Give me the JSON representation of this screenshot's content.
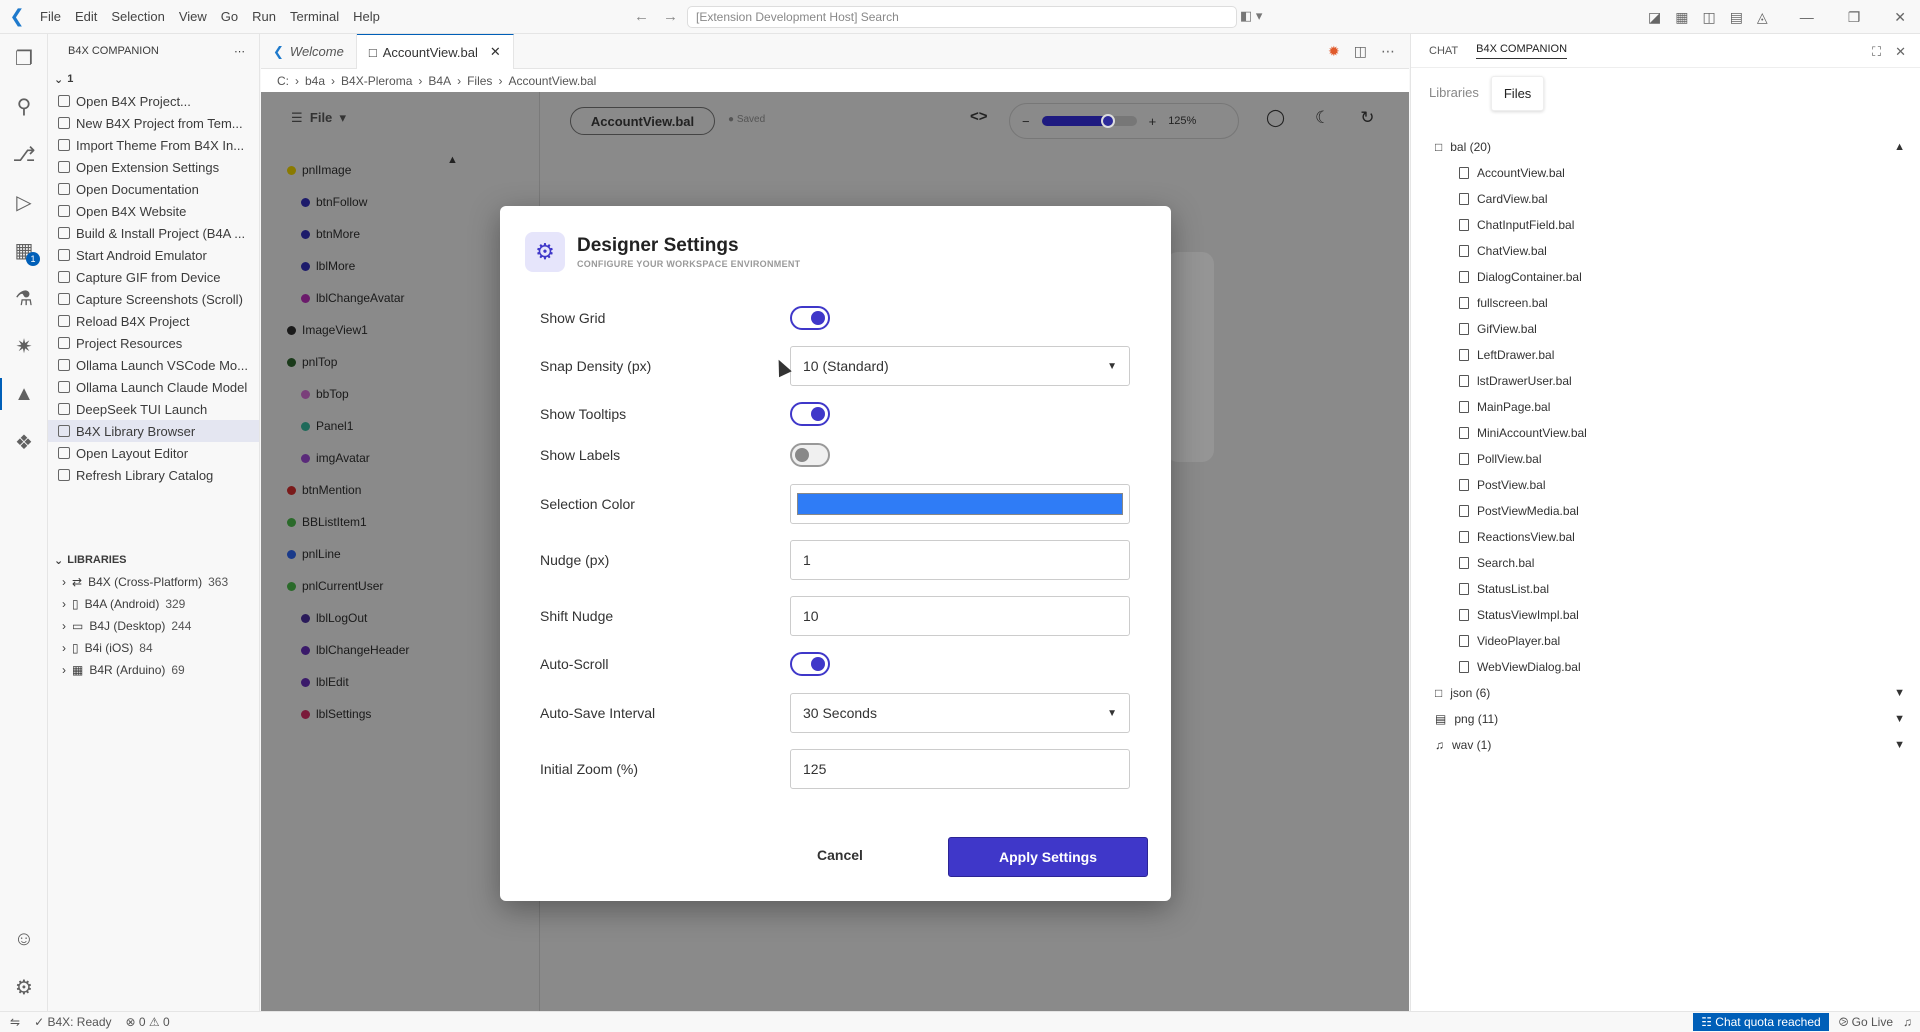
{
  "menu": [
    "File",
    "Edit",
    "Selection",
    "View",
    "Go",
    "Run",
    "Terminal",
    "Help"
  ],
  "command_center": "[Extension Development Host] Search",
  "sidebar": {
    "title": "B4X COMPANION",
    "section": "1",
    "commands": [
      "Open B4X Project...",
      "New B4X Project from Tem...",
      "Import Theme From B4X In...",
      "Open Extension Settings",
      "Open Documentation",
      "Open B4X Website",
      "Build & Install Project (B4A ...",
      "Start Android Emulator",
      "Capture GIF from Device",
      "Capture Screenshots (Scroll)",
      "Reload B4X Project",
      "Project Resources",
      "Ollama Launch VSCode Mo...",
      "Ollama Launch Claude Model",
      "DeepSeek TUI Launch",
      "B4X Library Browser",
      "Open Layout Editor",
      "Refresh Library Catalog"
    ],
    "libraries_title": "LIBRARIES",
    "libraries": [
      {
        "name": "B4X (Cross-Platform)",
        "count": "363"
      },
      {
        "name": "B4A (Android)",
        "count": "329"
      },
      {
        "name": "B4J (Desktop)",
        "count": "244"
      },
      {
        "name": "B4i (iOS)",
        "count": "84"
      },
      {
        "name": "B4R (Arduino)",
        "count": "69"
      }
    ]
  },
  "tabs": {
    "welcome": "Welcome",
    "active": "AccountView.bal"
  },
  "breadcrumb": [
    "C:",
    "b4a",
    "B4X-Pleroma",
    "B4A",
    "Files",
    "AccountView.bal"
  ],
  "designer": {
    "file_menu": "File",
    "layout_name": "AccountView.bal",
    "saved": "Saved",
    "code_toggle": "<>",
    "zoom_minus": "−",
    "zoom_plus": "+",
    "zoom_value": "125%",
    "zoom_level": 0.7,
    "tree": [
      {
        "name": "pnlImage",
        "level": 0,
        "color": "#8a7a00"
      },
      {
        "name": "btnFollow",
        "level": 1,
        "color": "#1d1b6b"
      },
      {
        "name": "btnMore",
        "level": 1,
        "color": "#1d1b6b"
      },
      {
        "name": "lblMore",
        "level": 1,
        "color": "#1d1b6b"
      },
      {
        "name": "lblChangeAvatar",
        "level": 1,
        "color": "#6b1a6b"
      },
      {
        "name": "ImageView1",
        "level": 0,
        "color": "#1a1a1a"
      },
      {
        "name": "pnlTop",
        "level": 0,
        "color": "#1a3a1a"
      },
      {
        "name": "bbTop",
        "level": 1,
        "color": "#7a3f7a"
      },
      {
        "name": "Panel1",
        "level": 1,
        "color": "#1f6a5a"
      },
      {
        "name": "imgAvatar",
        "level": 1,
        "color": "#5a2a7a"
      },
      {
        "name": "btnMention",
        "level": 0,
        "color": "#7a1a1a"
      },
      {
        "name": "BBListItem1",
        "level": 0,
        "color": "#2a6a2a"
      },
      {
        "name": "pnlLine",
        "level": 0,
        "color": "#1a3a8a"
      },
      {
        "name": "pnlCurrentUser",
        "level": 0,
        "color": "#2a6a2a"
      },
      {
        "name": "lblLogOut",
        "level": 1,
        "color": "#2a1a5a"
      },
      {
        "name": "lblChangeHeader",
        "level": 1,
        "color": "#3a1a6a"
      },
      {
        "name": "lblEdit",
        "level": 1,
        "color": "#3a1a6a"
      },
      {
        "name": "lblSettings",
        "level": 1,
        "color": "#7a1a3a"
      }
    ]
  },
  "modal": {
    "title": "Designer Settings",
    "subtitle": "CONFIGURE YOUR WORKSPACE ENVIRONMENT",
    "show_grid": {
      "label": "Show Grid",
      "on": true
    },
    "snap_density": {
      "label": "Snap Density (px)",
      "value": "10 (Standard)"
    },
    "show_tooltips": {
      "label": "Show Tooltips",
      "on": true
    },
    "show_labels": {
      "label": "Show Labels",
      "on": false
    },
    "selection_color": {
      "label": "Selection Color",
      "value": "#2f7cf6"
    },
    "nudge": {
      "label": "Nudge (px)",
      "value": "1"
    },
    "shift_nudge": {
      "label": "Shift Nudge",
      "value": "10"
    },
    "auto_scroll": {
      "label": "Auto-Scroll",
      "on": true
    },
    "auto_save": {
      "label": "Auto-Save Interval",
      "value": "30 Seconds"
    },
    "initial_zoom": {
      "label": "Initial Zoom (%)",
      "value": "125"
    },
    "cancel": "Cancel",
    "apply": "Apply Settings"
  },
  "aux": {
    "tab_chat": "CHAT",
    "tab_b4x": "B4X COMPANION",
    "subtab_libraries": "Libraries",
    "subtab_files": "Files",
    "folders": [
      {
        "name": "bal (20)",
        "expanded": true,
        "files": [
          "AccountView.bal",
          "CardView.bal",
          "ChatInputField.bal",
          "ChatView.bal",
          "DialogContainer.bal",
          "fullscreen.bal",
          "GifView.bal",
          "LeftDrawer.bal",
          "lstDrawerUser.bal",
          "MainPage.bal",
          "MiniAccountView.bal",
          "PollView.bal",
          "PostView.bal",
          "PostViewMedia.bal",
          "ReactionsView.bal",
          "Search.bal",
          "StatusList.bal",
          "StatusViewImpl.bal",
          "VideoPlayer.bal",
          "WebViewDialog.bal"
        ]
      },
      {
        "name": "json (6)",
        "expanded": false,
        "files": []
      },
      {
        "name": "png (11)",
        "expanded": false,
        "files": []
      },
      {
        "name": "wav (1)",
        "expanded": false,
        "files": []
      }
    ]
  },
  "status": {
    "ready": "B4X: Ready",
    "errors": "0",
    "warnings": "0",
    "quota": "Chat quota reached",
    "golive": "Go Live"
  },
  "colors": {
    "accent": "#3f37c9",
    "vscode_blue": "#005fb8"
  }
}
